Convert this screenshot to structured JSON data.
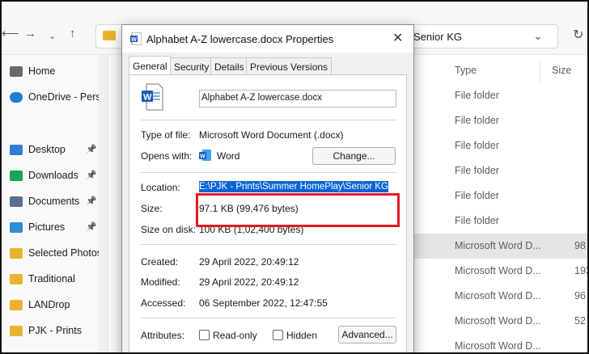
{
  "explorer": {
    "address_text": "Senior KG",
    "sidebar": [
      {
        "label": "Home",
        "icon": "home-icon"
      },
      {
        "label": "OneDrive - Perso",
        "icon": "cloud-icon"
      },
      {
        "label": "Desktop",
        "icon": "desktop-icon",
        "pinned": true
      },
      {
        "label": "Downloads",
        "icon": "download-icon",
        "pinned": true
      },
      {
        "label": "Documents",
        "icon": "documents-icon",
        "pinned": true
      },
      {
        "label": "Pictures",
        "icon": "pictures-icon",
        "pinned": true
      },
      {
        "label": "Selected Photos",
        "icon": "folder-icon"
      },
      {
        "label": "Traditional",
        "icon": "folder-icon"
      },
      {
        "label": "LANDrop",
        "icon": "folder-icon"
      },
      {
        "label": "PJK - Prints",
        "icon": "folder-icon"
      }
    ],
    "columns": {
      "type": "Type",
      "size": "Size"
    },
    "rows": [
      {
        "type": "File folder",
        "size": ""
      },
      {
        "type": "File folder",
        "size": ""
      },
      {
        "type": "File folder",
        "size": ""
      },
      {
        "type": "File folder",
        "size": ""
      },
      {
        "type": "File folder",
        "size": ""
      },
      {
        "type": "File folder",
        "size": ""
      },
      {
        "type": "Microsoft Word D...",
        "size": "98",
        "selected": true
      },
      {
        "type": "Microsoft Word D...",
        "size": "193",
        "selected": false
      },
      {
        "type": "Microsoft Word D...",
        "size": "96",
        "selected": false
      },
      {
        "type": "Microsoft Word D...",
        "size": "52",
        "selected": false
      },
      {
        "type": "Microsoft Word D...",
        "size": "",
        "selected": false
      }
    ]
  },
  "dialog": {
    "title": "Alphabet A-Z lowercase.docx Properties",
    "tabs": [
      "General",
      "Security",
      "Details",
      "Previous Versions"
    ],
    "active_tab": "General",
    "filename": "Alphabet A-Z lowercase.docx",
    "type_label": "Type of file:",
    "type_value": "Microsoft Word Document (.docx)",
    "opens_label": "Opens with:",
    "opens_value": "Word",
    "change_button": "Change...",
    "location_label": "Location:",
    "location_value": "E:\\PJK - Prints\\Summer HomePlay\\Senior KG",
    "size_label": "Size:",
    "size_value": "97.1 KB (99,476 bytes)",
    "disk_label": "Size on disk:",
    "disk_value": "100 KB (1,02,400 bytes)",
    "created_label": "Created:",
    "created_value": "29 April 2022, 20:49:12",
    "modified_label": "Modified:",
    "modified_value": "29 April 2022, 20:49:12",
    "accessed_label": "Accessed:",
    "accessed_value": "06 September 2022, 12:47:55",
    "attributes_label": "Attributes:",
    "readonly_label": "Read-only",
    "hidden_label": "Hidden",
    "advanced_button": "Advanced..."
  },
  "colors": {
    "highlight_box": "#e01b24",
    "selection": "#0a64d6",
    "word_blue": "#185abd",
    "folder": "#e8b42f"
  }
}
